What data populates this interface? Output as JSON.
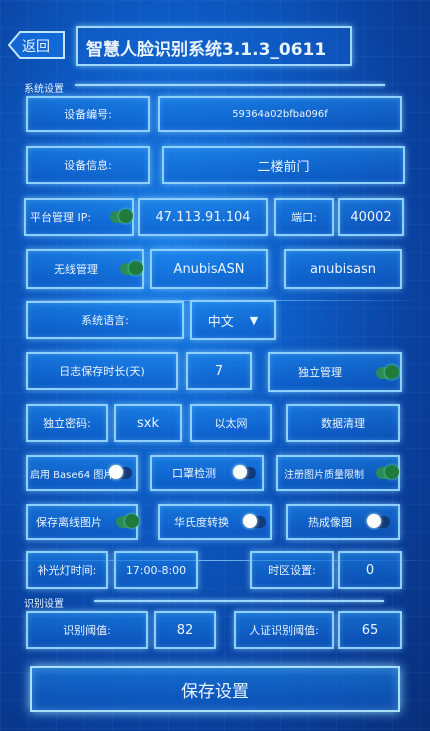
{
  "header": {
    "back_label": "返回",
    "title": "智慧人脸识别系统3.1.3_0611"
  },
  "sections": {
    "system": "系统设置",
    "recognition": "识别设置"
  },
  "device": {
    "id_label": "设备编号:",
    "id_value": "59364a02bfba096f",
    "info_label": "设备信息:",
    "info_value": "二楼前门"
  },
  "platform": {
    "label": "平台管理 IP:",
    "enabled": true,
    "ip": "47.113.91.104",
    "port_label": "端口:",
    "port": "40002"
  },
  "wireless": {
    "label": "无线管理",
    "enabled": true,
    "ssid": "AnubisASN",
    "password": "anubisasn"
  },
  "language": {
    "label": "系统语言:",
    "value": "中文"
  },
  "log": {
    "label": "日志保存时长(天)",
    "days": "7",
    "independent_label": "独立管理",
    "independent_enabled": true
  },
  "password_row": {
    "label": "独立密码:",
    "value": "sxk",
    "network": "以太网",
    "clear_button": "数据清理"
  },
  "options": {
    "base64": {
      "label": "启用 Base64 图片",
      "enabled": false
    },
    "mask": {
      "label": "口罩检测",
      "enabled": false
    },
    "quality": {
      "label": "注册图片质量限制",
      "enabled": true
    },
    "offline": {
      "label": "保存离线图片",
      "enabled": true
    },
    "fahrenheit": {
      "label": "华氏度转换",
      "enabled": false
    },
    "thermal": {
      "label": "热成像图",
      "enabled": false
    }
  },
  "light": {
    "label": "补光灯时间:",
    "value": "17:00-8:00"
  },
  "timezone": {
    "label": "时区设置:",
    "value": "0"
  },
  "recognition": {
    "threshold_label": "识别阈值:",
    "threshold": "82",
    "id_threshold_label": "人证识别阈值:",
    "id_threshold": "65"
  },
  "save_button": "保存设置"
}
